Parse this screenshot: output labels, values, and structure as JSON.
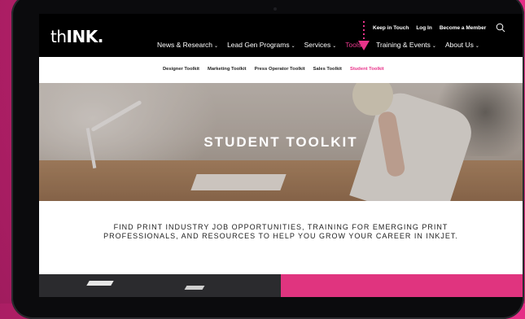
{
  "site": {
    "logo": {
      "prefix": "th",
      "bold": "INK."
    }
  },
  "utility_nav": [
    "Keep in Touch",
    "Log In",
    "Become a Member"
  ],
  "main_nav": [
    {
      "label": "News & Research",
      "caret": "⌄",
      "active": false
    },
    {
      "label": "Lead Gen Programs",
      "caret": "⌄",
      "active": false
    },
    {
      "label": "Services",
      "caret": "⌄",
      "active": false
    },
    {
      "label": "Tools",
      "caret": "⌄",
      "active": true
    },
    {
      "label": "Training & Events",
      "caret": "⌄",
      "active": false
    },
    {
      "label": "About Us",
      "caret": "⌄",
      "active": false
    }
  ],
  "sub_nav": [
    "Designer Toolkit",
    "Marketing Toolkit",
    "Press Operator Toolkit",
    "Sales Toolkit",
    "Student Toolkit"
  ],
  "hero": {
    "title": "STUDENT TOOLKIT"
  },
  "intro": {
    "text": "FIND PRINT INDUSTRY JOB OPPORTUNITIES, TRAINING FOR EMERGING PRINT PROFESSIONALS, AND RESOURCES TO HELP YOU GROW YOUR CAREER IN INKJET."
  },
  "icons": {
    "search": "search-icon",
    "pointer": "pointer-arrow-icon"
  },
  "colors": {
    "accent": "#e8338a",
    "background": "#d6297c",
    "nav_bg": "#000000"
  }
}
